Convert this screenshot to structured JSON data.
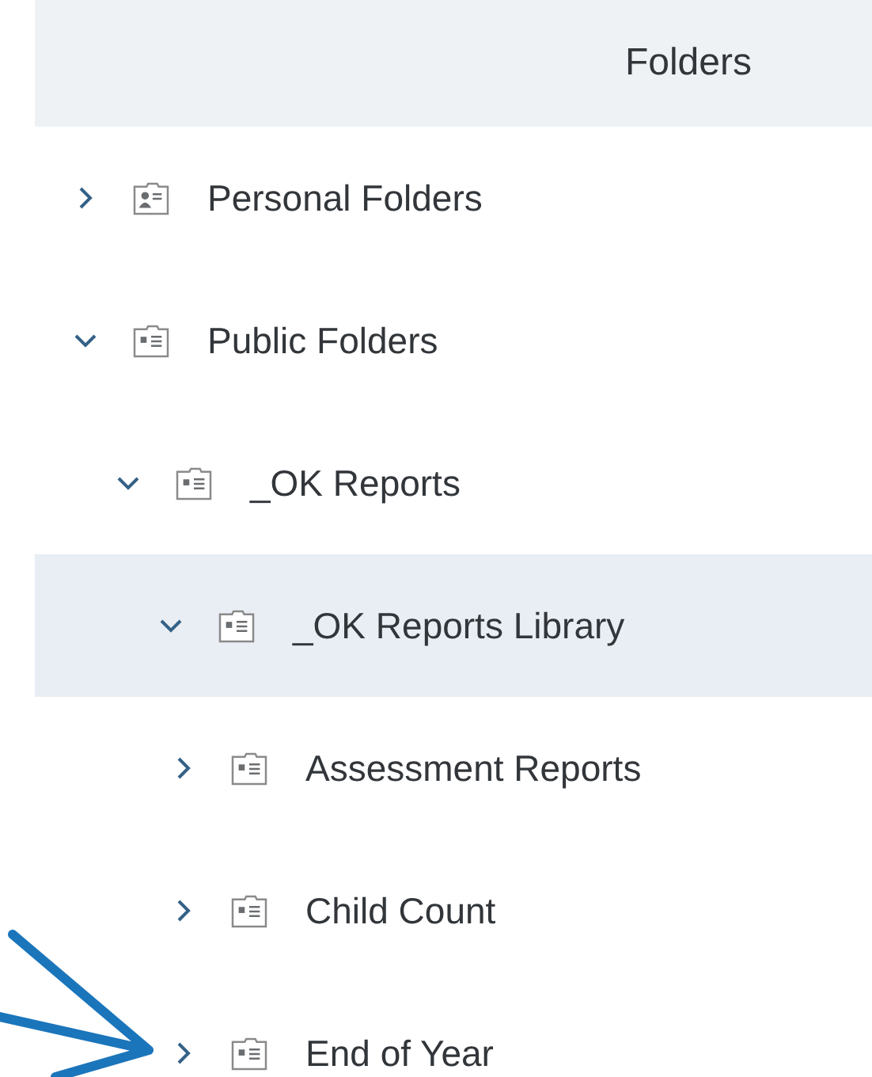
{
  "header": {
    "title": "Folders"
  },
  "tree": [
    {
      "label": "Personal Folders",
      "kind": "personal",
      "expanded": false,
      "selected": false
    },
    {
      "label": "Public Folders",
      "kind": "public",
      "expanded": true,
      "selected": false,
      "children": [
        {
          "label": "_OK Reports",
          "kind": "public",
          "expanded": true,
          "selected": false,
          "children": [
            {
              "label": "_OK Reports Library",
              "kind": "public",
              "expanded": true,
              "selected": true,
              "children": [
                {
                  "label": "Assessment Reports",
                  "kind": "public",
                  "expanded": false,
                  "selected": false
                },
                {
                  "label": "Child Count",
                  "kind": "public",
                  "expanded": false,
                  "selected": false
                },
                {
                  "label": "End of Year",
                  "kind": "public",
                  "expanded": false,
                  "selected": false
                }
              ]
            }
          ]
        }
      ]
    }
  ]
}
